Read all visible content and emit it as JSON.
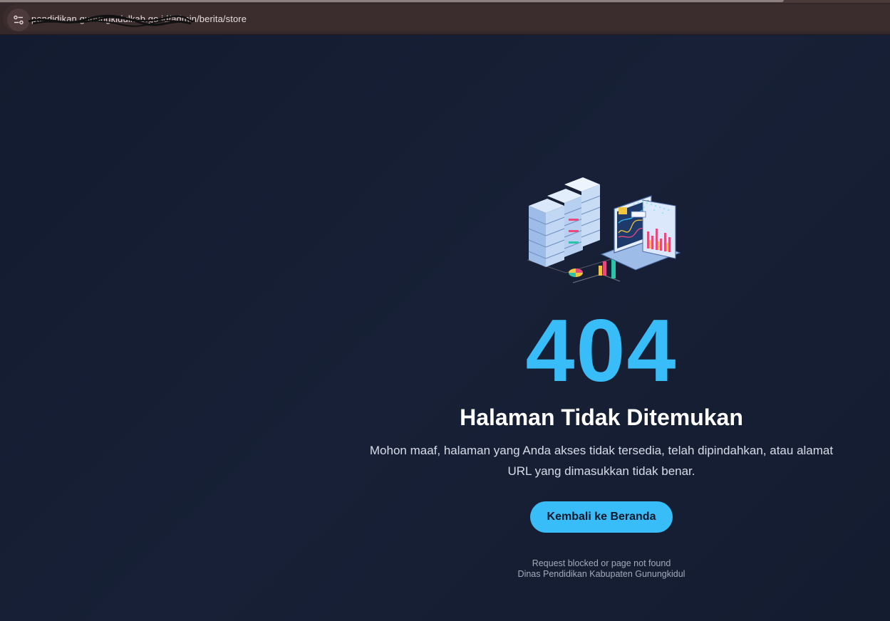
{
  "browser": {
    "url": "pendidikan.gunungkidulkab.go.id/admin/berita/store",
    "site_controls_icon": "tune-icon"
  },
  "error": {
    "code": "404",
    "title": "Halaman Tidak Ditemukan",
    "message": "Mohon maaf, halaman yang Anda akses tidak tersedia, telah dipindahkan, atau alamat URL yang dimasukkan tidak benar.",
    "home_button_label": "Kembali ke Beranda",
    "footer_line1": "Request blocked or page not found",
    "footer_line2": "Dinas Pendidikan Kabupaten Gunungkidul"
  },
  "colors": {
    "background": "#141d31",
    "accent": "#38bdf8",
    "title": "#ffffff",
    "text": "#d7dde8",
    "muted": "#a3acbb"
  },
  "illustration_icon": "server-analytics-illustration-icon"
}
